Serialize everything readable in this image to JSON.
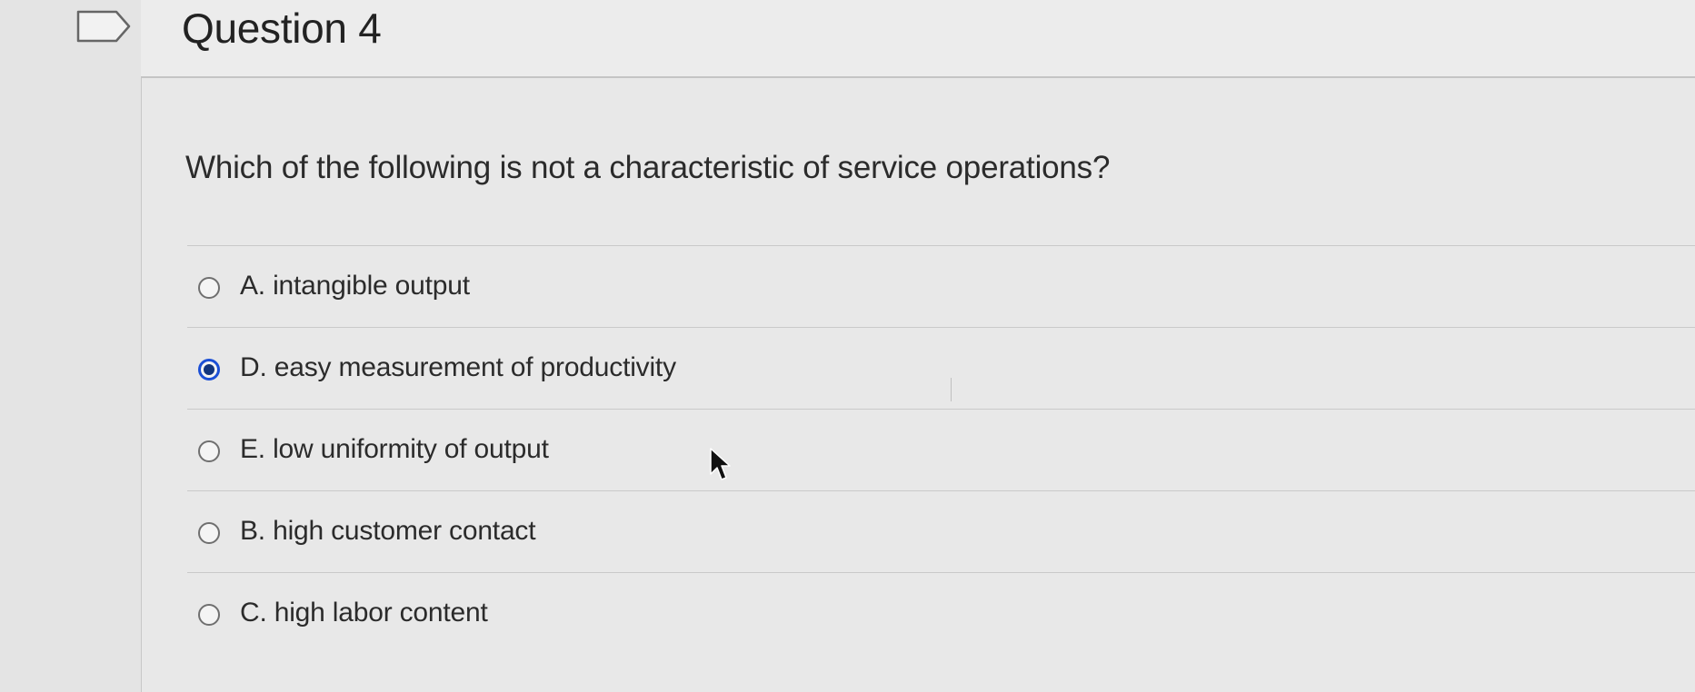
{
  "question": {
    "title": "Question 4",
    "text": "Which of the following is not a characteristic of service operations?"
  },
  "answers": [
    {
      "label": "A. intangible output",
      "selected": false
    },
    {
      "label": "D. easy measurement of productivity",
      "selected": true
    },
    {
      "label": "E. low uniformity of output",
      "selected": false
    },
    {
      "label": "B. high customer contact",
      "selected": false
    },
    {
      "label": "C. high labor content",
      "selected": false
    }
  ],
  "icons": {
    "flag": "flag-outline-icon",
    "cursor": "mouse-pointer-icon"
  },
  "colors": {
    "selected_ring": "#1b4fd6",
    "selected_dot": "#12357e",
    "text": "#2b2b2b"
  }
}
